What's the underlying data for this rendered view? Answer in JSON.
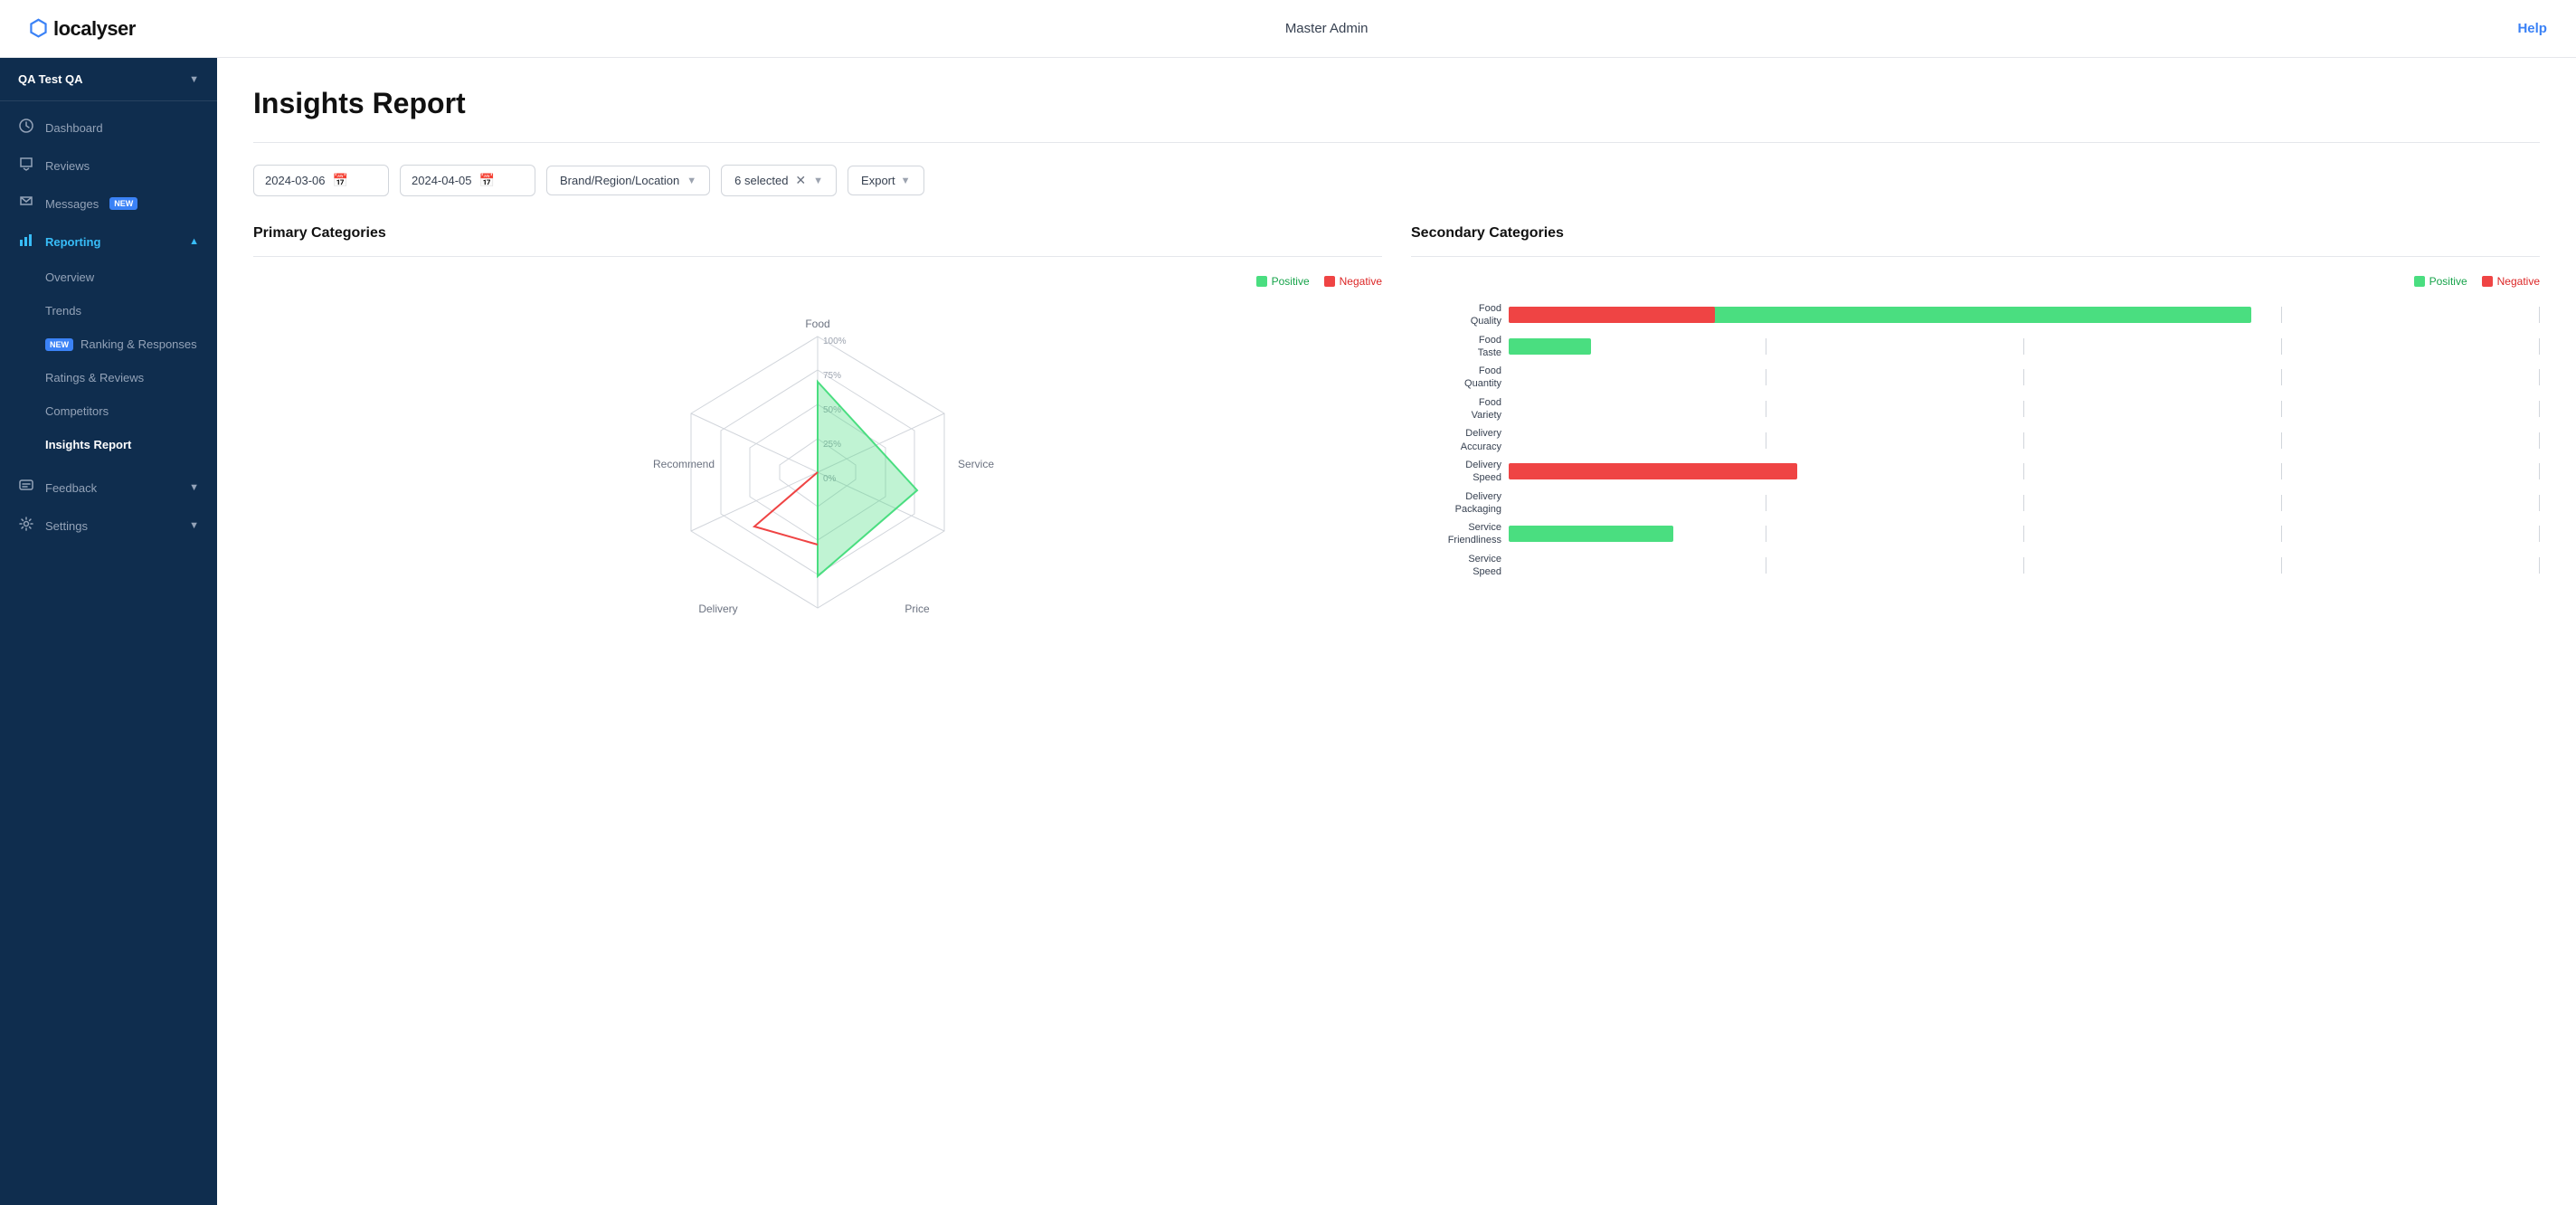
{
  "topbar": {
    "logo_text": "localyser",
    "admin_label": "Master Admin",
    "help_label": "Help"
  },
  "sidebar": {
    "org_name": "QA Test QA",
    "nav_items": [
      {
        "id": "dashboard",
        "label": "Dashboard",
        "icon": "📊",
        "active": false
      },
      {
        "id": "reviews",
        "label": "Reviews",
        "icon": "💬",
        "active": false
      },
      {
        "id": "messages",
        "label": "Messages",
        "icon": "🗨️",
        "badge": "NEW",
        "active": false
      },
      {
        "id": "reporting",
        "label": "Reporting",
        "icon": "📈",
        "active": true,
        "expanded": true,
        "children": [
          {
            "id": "overview",
            "label": "Overview"
          },
          {
            "id": "trends",
            "label": "Trends"
          },
          {
            "id": "ranking-responses",
            "label": "Ranking & Responses",
            "badge": "NEW"
          },
          {
            "id": "ratings-reviews",
            "label": "Ratings & Reviews"
          },
          {
            "id": "competitors",
            "label": "Competitors"
          },
          {
            "id": "insights-report",
            "label": "Insights Report",
            "active": true
          }
        ]
      },
      {
        "id": "feedback",
        "label": "Feedback",
        "icon": "✉️",
        "active": false
      },
      {
        "id": "settings",
        "label": "Settings",
        "icon": "⚙️",
        "active": false
      }
    ]
  },
  "page": {
    "title": "Insights Report",
    "filters": {
      "date_from": "2024-03-06",
      "date_to": "2024-04-05",
      "location_label": "Brand/Region/Location",
      "selected_count": "6 selected",
      "export_label": "Export"
    },
    "primary_chart": {
      "title": "Primary Categories",
      "legend_positive": "Positive",
      "legend_negative": "Negative",
      "axes": [
        "Food",
        "Service",
        "Price",
        "Delivery",
        "Recommend"
      ],
      "radar_labels": {
        "top": "Food",
        "right": "Service",
        "bottom_right": "Price",
        "bottom_left": "Delivery",
        "left": "Recommend"
      },
      "pct_labels": [
        "100%",
        "75%",
        "50%",
        "25%",
        "0%"
      ]
    },
    "secondary_chart": {
      "title": "Secondary Categories",
      "legend_positive": "Positive",
      "legend_negative": "Negative",
      "bars": [
        {
          "label": "Food\nQuality",
          "positive": 72,
          "negative": 20
        },
        {
          "label": "Food\nTaste",
          "positive": 8,
          "negative": 0
        },
        {
          "label": "Food\nQuantity",
          "positive": 0,
          "negative": 0
        },
        {
          "label": "Food\nVariety",
          "positive": 0,
          "negative": 0
        },
        {
          "label": "Delivery\nAccuracy",
          "positive": 0,
          "negative": 0
        },
        {
          "label": "Delivery\nSpeed",
          "positive": 0,
          "negative": 28
        },
        {
          "label": "Delivery\nPackaging",
          "positive": 0,
          "negative": 0
        },
        {
          "label": "Service\nFriendliness",
          "positive": 16,
          "negative": 0
        },
        {
          "label": "Service\nSpeed",
          "positive": 0,
          "negative": 0
        }
      ]
    }
  }
}
